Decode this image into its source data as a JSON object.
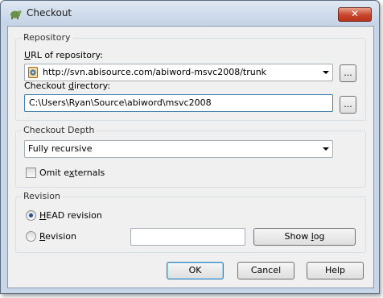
{
  "window": {
    "title": "Checkout",
    "close_label": "✕"
  },
  "repository": {
    "group_title": "Repository",
    "url_label_pre": "",
    "url_label_u": "U",
    "url_label_post": "RL of repository:",
    "url_value": "http://svn.abisource.com/abiword-msvc2008/trunk",
    "browse_url_label": "...",
    "dir_label_pre": "Checkout ",
    "dir_label_u": "d",
    "dir_label_post": "irectory:",
    "dir_value": "C:\\Users\\Ryan\\Source\\abiword\\msvc2008",
    "browse_dir_label": "..."
  },
  "depth": {
    "group_title": "Checkout Depth",
    "selected": "Fully recursive",
    "omit_pre": "Omit e",
    "omit_u": "x",
    "omit_post": "ternals",
    "omit_checked": false
  },
  "revision": {
    "group_title": "Revision",
    "head_pre": "",
    "head_u": "H",
    "head_post": "EAD revision",
    "head_selected": true,
    "rev_pre": "",
    "rev_u": "R",
    "rev_post": "evision",
    "rev_value": "",
    "show_log_pre": "Show ",
    "show_log_u": "l",
    "show_log_post": "og"
  },
  "buttons": {
    "ok": "OK",
    "cancel": "Cancel",
    "help": "Help"
  }
}
